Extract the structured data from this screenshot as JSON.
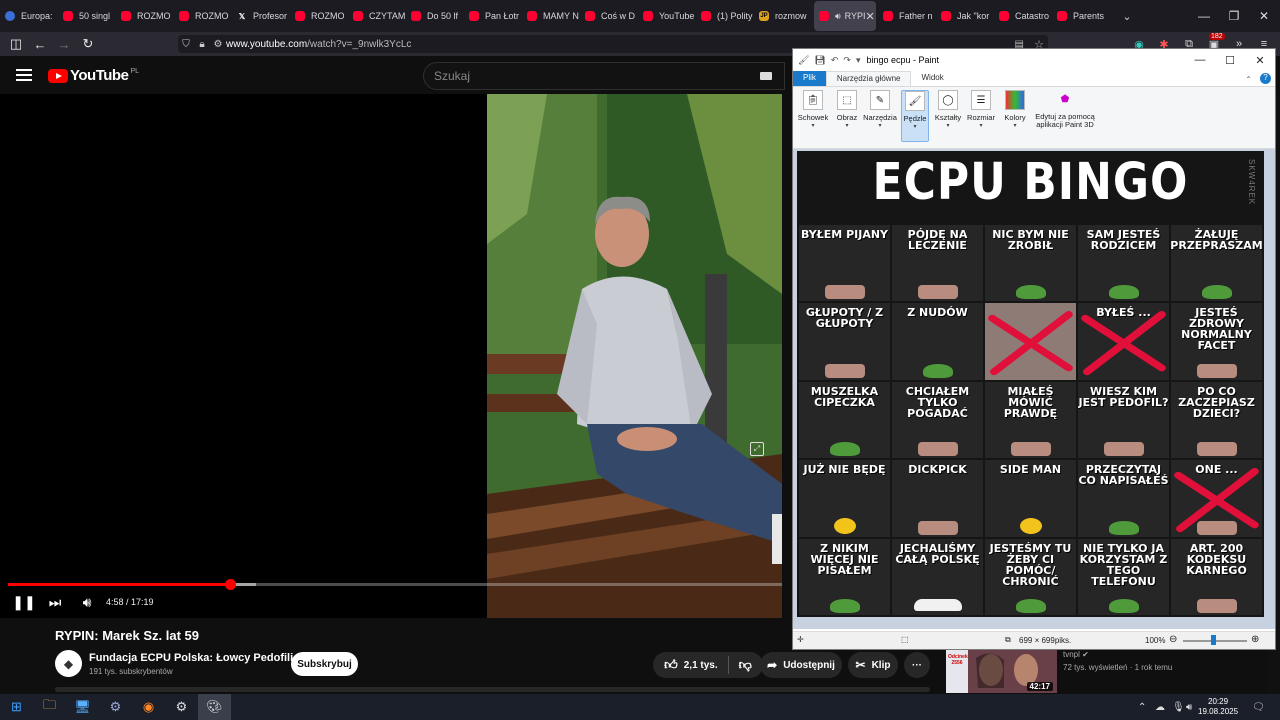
{
  "browser": {
    "tabs": [
      {
        "label": "Europa:",
        "icon": "globe-icon",
        "kind": "euro"
      },
      {
        "label": "50 singl",
        "icon": "youtube-icon",
        "kind": "yt"
      },
      {
        "label": "ROZMO",
        "icon": "youtube-icon",
        "kind": "yt"
      },
      {
        "label": "ROZMO",
        "icon": "youtube-icon",
        "kind": "yt"
      },
      {
        "label": "Profesor",
        "icon": "x-logo-icon",
        "kind": "x"
      },
      {
        "label": "ROZMO",
        "icon": "youtube-icon",
        "kind": "yt"
      },
      {
        "label": "CZYTAM",
        "icon": "youtube-icon",
        "kind": "yt"
      },
      {
        "label": "Do 50 lf",
        "icon": "youtube-icon",
        "kind": "yt"
      },
      {
        "label": "Pan Łotr",
        "icon": "youtube-icon",
        "kind": "yt"
      },
      {
        "label": "MAMY N",
        "icon": "youtube-icon",
        "kind": "yt"
      },
      {
        "label": "Coś w D",
        "icon": "youtube-icon",
        "kind": "yt"
      },
      {
        "label": "YouTube",
        "icon": "youtube-icon",
        "kind": "yt"
      },
      {
        "label": "(1) Polity",
        "icon": "youtube-icon",
        "kind": "yt"
      },
      {
        "label": "rozmow",
        "icon": "jp-icon",
        "kind": "jp"
      }
    ],
    "active_tab": {
      "label": "RYPI"
    },
    "tabs_after": [
      {
        "label": "Father n",
        "icon": "youtube-icon",
        "kind": "yt"
      },
      {
        "label": "Jak \"kor",
        "icon": "youtube-icon",
        "kind": "yt"
      },
      {
        "label": "Catastro",
        "icon": "youtube-icon",
        "kind": "yt"
      },
      {
        "label": "Parents",
        "icon": "youtube-icon",
        "kind": "yt"
      }
    ],
    "url_host": "www.youtube.com",
    "url_path": "/watch?v=_9nwlk3YcLc",
    "extension_badge": "182"
  },
  "youtube": {
    "logo_text": "YouTube",
    "country_code": "PL",
    "search_placeholder": "Szukaj",
    "player": {
      "current_time": "4:58",
      "duration": "17:19",
      "time_display": "4:58 / 17:19",
      "progress_fraction": 0.287,
      "buffer_fraction": 0.32
    },
    "video_title": "RYPIN: Marek Sz. lat 59",
    "channel_name": "Fundacja ECPU Polska: Łowcy Pedofili",
    "subscribers": "191 tys. subskrybentów",
    "subscribe_label": "Subskrybuj",
    "likes": "2,1 tys.",
    "share_label": "Udostępnij",
    "clip_label": "Klip",
    "more_label": "···",
    "recommendation": {
      "channel": "tvnpl",
      "meta": "72 tys. wyświetleń · 1 rok temu",
      "duration": "42:17",
      "thumb_text": "Odcinek 2556"
    }
  },
  "paint": {
    "title": "bingo ecpu - Paint",
    "ribbon_tabs": [
      "Plik",
      "Narzędzia główne",
      "Widok"
    ],
    "groups": [
      "Schowek",
      "Obraz",
      "Narzędzia",
      "Pędzle",
      "Kształty",
      "Rozmiar",
      "Kolory",
      "Edytuj za pomocą aplikacji Paint 3D"
    ],
    "dimensions": "699 × 699piks.",
    "zoom": "100%",
    "bingo": {
      "title": "ECPU BINGO",
      "watermark": "SKW4REK",
      "cells": [
        {
          "text": "BYŁEM PIJANY",
          "art": "face",
          "crossed": false
        },
        {
          "text": "PÓJDĘ NA LECZENIE",
          "art": "face",
          "crossed": false
        },
        {
          "text": "NIC BYM NIE ZROBIŁ",
          "art": "frog",
          "crossed": false
        },
        {
          "text": "SAM JESTEŚ RODZICEM",
          "art": "frog",
          "crossed": false
        },
        {
          "text": "ŻAŁUJĘ PRZEPRASZAM",
          "art": "frog",
          "crossed": false
        },
        {
          "text": "GŁUPOTY / Z GŁUPOTY",
          "art": "face",
          "crossed": false
        },
        {
          "text": "Z NUDÓW",
          "art": "frog",
          "crossed": false
        },
        {
          "text": "",
          "art": "photo",
          "crossed": true
        },
        {
          "text": "BYŁEŚ ...",
          "art": "none",
          "crossed": true
        },
        {
          "text": "JESTEŚ ZDROWY NORMALNY FACET",
          "art": "face",
          "crossed": false
        },
        {
          "text": "MUSZELKA CIPECZKA",
          "art": "frog",
          "crossed": false
        },
        {
          "text": "CHCIAŁEM TYLKO POGADAĆ",
          "art": "face",
          "crossed": false
        },
        {
          "text": "MIAŁEŚ MÓWIĆ PRAWDĘ",
          "art": "face",
          "crossed": false
        },
        {
          "text": "WIESZ KIM JEST PEDOFIL?",
          "art": "face",
          "crossed": false
        },
        {
          "text": "PO CO ZACZEPIASZ DZIECI?",
          "art": "face",
          "crossed": false
        },
        {
          "text": "JUŻ NIE BĘDĘ",
          "art": "duck",
          "crossed": false
        },
        {
          "text": "DICKPICK",
          "art": "face",
          "crossed": false
        },
        {
          "text": "SIDE MAN",
          "art": "duck",
          "crossed": false
        },
        {
          "text": "PRZECZYTAJ CO NAPISAŁEŚ",
          "art": "frog",
          "crossed": false
        },
        {
          "text": "ONE ...",
          "art": "face",
          "crossed": true
        },
        {
          "text": "Z NIKIM WIĘCEJ NIE PISAŁEM",
          "art": "frog",
          "crossed": false
        },
        {
          "text": "JECHALIŚMY CAŁĄ POLSKĘ",
          "art": "car",
          "crossed": false
        },
        {
          "text": "JESTEŚMY TU ŻEBY CI POMÓC/ CHRONIĆ",
          "art": "frog",
          "crossed": false
        },
        {
          "text": "NIE TYLKO JA KORZYSTAM Z TEGO TELEFONU",
          "art": "frog",
          "crossed": false
        },
        {
          "text": "ART. 200 KODEKSU KARNEGO",
          "art": "face",
          "crossed": false
        }
      ]
    }
  },
  "taskbar": {
    "time": "20:29",
    "date": "19.08.2025"
  }
}
